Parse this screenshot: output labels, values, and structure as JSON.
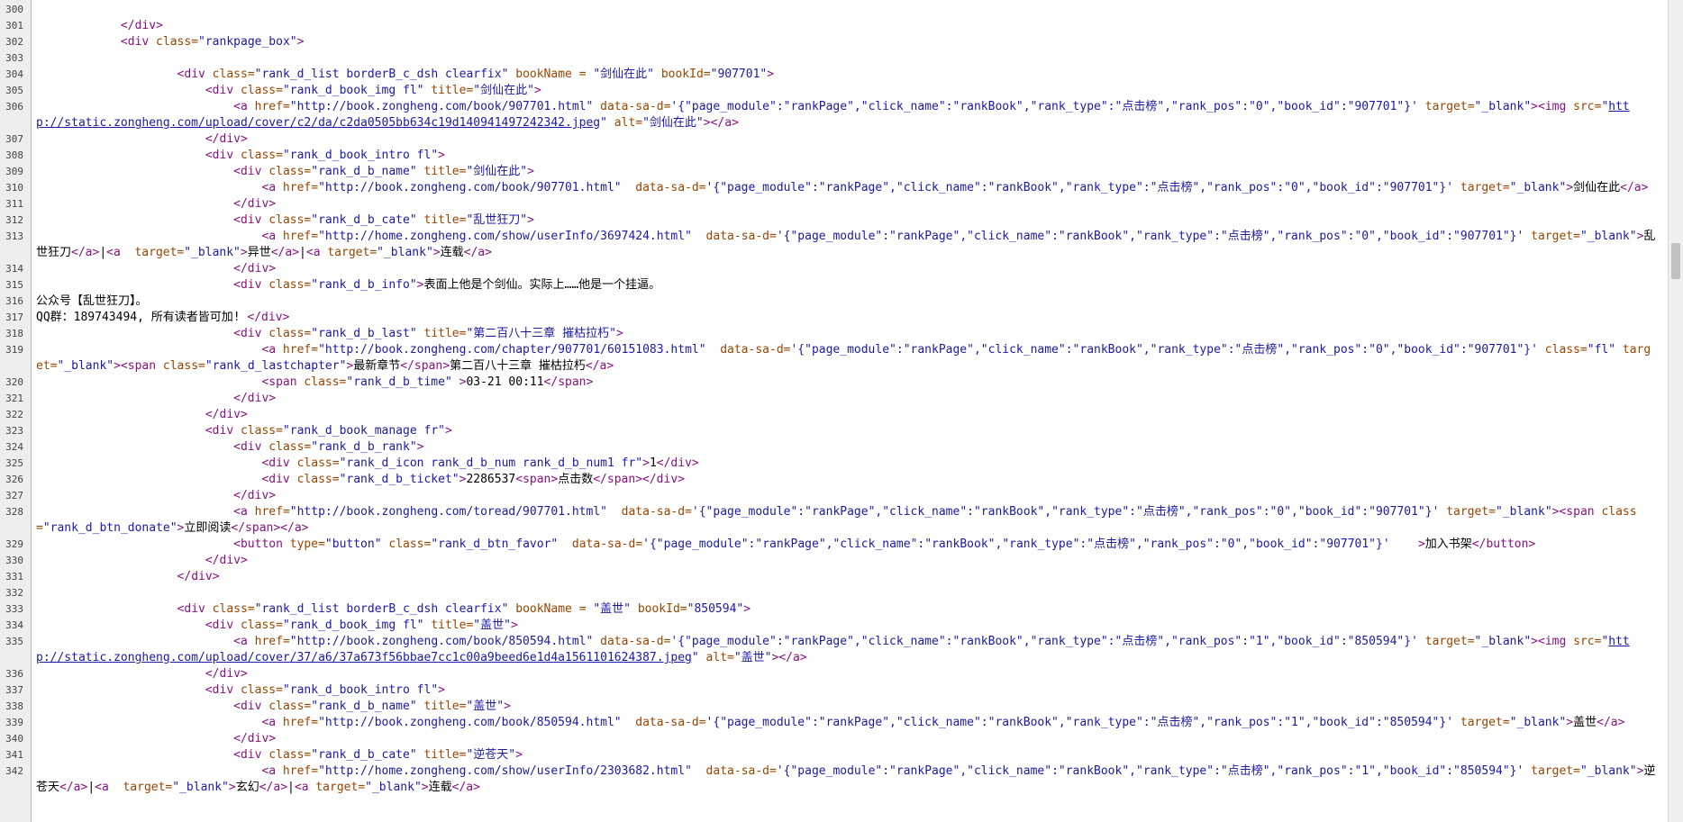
{
  "viewer": {
    "title": "HTML source view",
    "lines": [
      {
        "num": "300",
        "text": ""
      },
      {
        "num": "301",
        "text": "            </div>"
      },
      {
        "num": "302",
        "text": "            <div class=\"rankpage_box\">"
      },
      {
        "num": "303",
        "text": ""
      },
      {
        "num": "304",
        "text": "                    <div class=\"rank_d_list borderB_c_dsh clearfix\" bookName = \"剑仙在此\" bookId=\"907701\">"
      },
      {
        "num": "305",
        "text": "                        <div class=\"rank_d_book_img fl\" title=\"剑仙在此\">"
      },
      {
        "num": "306",
        "text": "                            <a href=\"http://book.zongheng.com/book/907701.html\" data-sa-d='{\"page_module\":\"rankPage\",\"click_name\":\"rankBook\",\"rank_type\":\"点击榜\",\"rank_pos\":\"0\",\"book_id\":\"907701\"}' target=\"_blank\"><img src=\"http://static.zongheng.com/upload/cover/c2/da/c2da0505bb634c19d140941497242342.jpeg\" alt=\"剑仙在此\"></a>"
      },
      {
        "num": "307",
        "text": "                        </div>"
      },
      {
        "num": "308",
        "text": "                        <div class=\"rank_d_book_intro fl\">"
      },
      {
        "num": "309",
        "text": "                            <div class=\"rank_d_b_name\" title=\"剑仙在此\">"
      },
      {
        "num": "310",
        "text": "                                <a href=\"http://book.zongheng.com/book/907701.html\"  data-sa-d='{\"page_module\":\"rankPage\",\"click_name\":\"rankBook\",\"rank_type\":\"点击榜\",\"rank_pos\":\"0\",\"book_id\":\"907701\"}' target=\"_blank\">剑仙在此</a>"
      },
      {
        "num": "311",
        "text": "                            </div>"
      },
      {
        "num": "312",
        "text": "                            <div class=\"rank_d_b_cate\" title=\"乱世狂刀\">"
      },
      {
        "num": "313",
        "text": "                                <a href=\"http://home.zongheng.com/show/userInfo/3697424.html\"  data-sa-d='{\"page_module\":\"rankPage\",\"click_name\":\"rankBook\",\"rank_type\":\"点击榜\",\"rank_pos\":\"0\",\"book_id\":\"907701\"}' target=\"_blank\">乱世狂刀</a>|<a  target=\"_blank\">异世</a>|<a target=\"_blank\">连载</a>"
      },
      {
        "num": "314",
        "text": "                            </div>"
      },
      {
        "num": "315",
        "text": "                            <div class=\"rank_d_b_info\">表面上他是个剑仙。实际上……他是一个挂逼。"
      },
      {
        "num": "316",
        "text": "公众号【乱世狂刀】。"
      },
      {
        "num": "317",
        "text": "QQ群：189743494, 所有读者皆可加! </div>"
      },
      {
        "num": "318",
        "text": "                            <div class=\"rank_d_b_last\" title=\"第二百八十三章 摧枯拉朽\">"
      },
      {
        "num": "319",
        "text": "                                <a href=\"http://book.zongheng.com/chapter/907701/60151083.html\"  data-sa-d='{\"page_module\":\"rankPage\",\"click_name\":\"rankBook\",\"rank_type\":\"点击榜\",\"rank_pos\":\"0\",\"book_id\":\"907701\"}' class=\"fl\" target=\"_blank\"><span class=\"rank_d_lastchapter\">最新章节</span>第二百八十三章 摧枯拉朽</a>"
      },
      {
        "num": "320",
        "text": "                                <span class=\"rank_d_b_time\" >03-21 00:11</span>"
      },
      {
        "num": "321",
        "text": "                            </div>"
      },
      {
        "num": "322",
        "text": "                        </div>"
      },
      {
        "num": "323",
        "text": "                        <div class=\"rank_d_book_manage fr\">"
      },
      {
        "num": "324",
        "text": "                            <div class=\"rank_d_b_rank\">"
      },
      {
        "num": "325",
        "text": "                                <div class=\"rank_d_icon rank_d_b_num rank_d_b_num1 fr\">1</div>"
      },
      {
        "num": "326",
        "text": "                                <div class=\"rank_d_b_ticket\">2286537<span>点击数</span></div>"
      },
      {
        "num": "327",
        "text": "                            </div>"
      },
      {
        "num": "328",
        "text": "                            <a href=\"http://book.zongheng.com/toread/907701.html\"  data-sa-d='{\"page_module\":\"rankPage\",\"click_name\":\"rankBook\",\"rank_type\":\"点击榜\",\"rank_pos\":\"0\",\"book_id\":\"907701\"}' target=\"_blank\"><span class=\"rank_d_btn_donate\">立即阅读</span></a>"
      },
      {
        "num": "329",
        "text": "                            <button type=\"button\" class=\"rank_d_btn_favor\"  data-sa-d='{\"page_module\":\"rankPage\",\"click_name\":\"rankBook\",\"rank_type\":\"点击榜\",\"rank_pos\":\"0\",\"book_id\":\"907701\"}'    >加入书架</button>"
      },
      {
        "num": "330",
        "text": "                        </div>"
      },
      {
        "num": "331",
        "text": "                    </div>"
      },
      {
        "num": "332",
        "text": ""
      },
      {
        "num": "333",
        "text": "                    <div class=\"rank_d_list borderB_c_dsh clearfix\" bookName = \"盖世\" bookId=\"850594\">"
      },
      {
        "num": "334",
        "text": "                        <div class=\"rank_d_book_img fl\" title=\"盖世\">"
      },
      {
        "num": "335",
        "text": "                            <a href=\"http://book.zongheng.com/book/850594.html\" data-sa-d='{\"page_module\":\"rankPage\",\"click_name\":\"rankBook\",\"rank_type\":\"点击榜\",\"rank_pos\":\"1\",\"book_id\":\"850594\"}' target=\"_blank\"><img src=\"http://static.zongheng.com/upload/cover/37/a6/37a673f56bbae7cc1c00a9beed6e1d4a1561101624387.jpeg\" alt=\"盖世\"></a>"
      },
      {
        "num": "336",
        "text": "                        </div>"
      },
      {
        "num": "337",
        "text": "                        <div class=\"rank_d_book_intro fl\">"
      },
      {
        "num": "338",
        "text": "                            <div class=\"rank_d_b_name\" title=\"盖世\">"
      },
      {
        "num": "339",
        "text": "                                <a href=\"http://book.zongheng.com/book/850594.html\"  data-sa-d='{\"page_module\":\"rankPage\",\"click_name\":\"rankBook\",\"rank_type\":\"点击榜\",\"rank_pos\":\"1\",\"book_id\":\"850594\"}' target=\"_blank\">盖世</a>"
      },
      {
        "num": "340",
        "text": "                            </div>"
      },
      {
        "num": "341",
        "text": "                            <div class=\"rank_d_b_cate\" title=\"逆苍天\">"
      },
      {
        "num": "342",
        "text": "                                <a href=\"http://home.zongheng.com/show/userInfo/2303682.html\"  data-sa-d='{\"page_module\":\"rankPage\",\"click_name\":\"rankBook\",\"rank_type\":\"点击榜\",\"rank_pos\":\"1\",\"book_id\":\"850594\"}' target=\"_blank\">逆苍天</a>|<a  target=\"_blank\">玄幻</a>|<a target=\"_blank\">连载</a>"
      }
    ]
  }
}
